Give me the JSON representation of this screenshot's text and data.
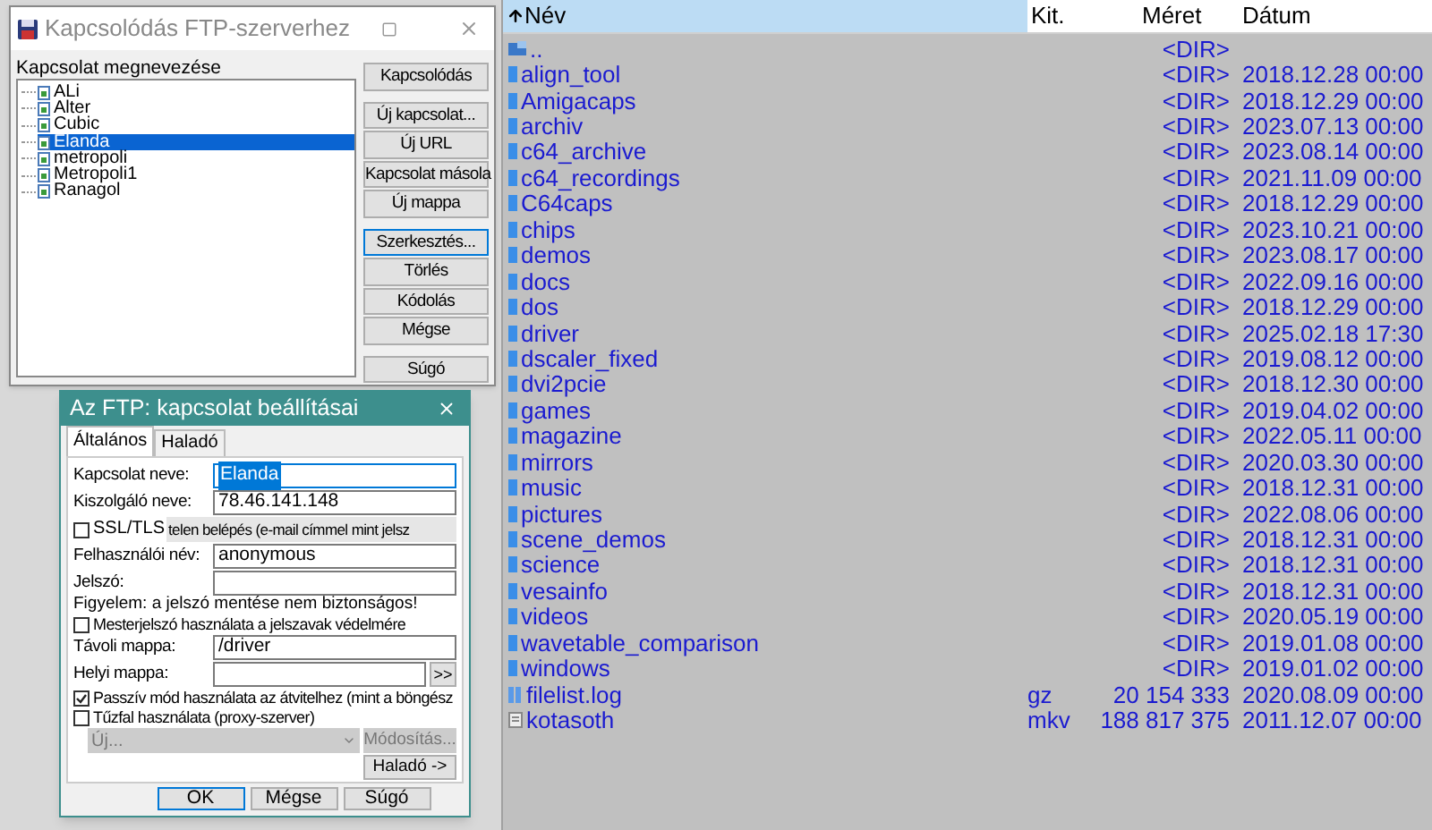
{
  "connect_dialog": {
    "title": "Kapcsolódás FTP-szerverhez",
    "list_label": "Kapcsolat megnevezése",
    "connections": [
      {
        "name": "ALi",
        "selected": false
      },
      {
        "name": "Alter",
        "selected": false
      },
      {
        "name": "Cubic",
        "selected": false
      },
      {
        "name": "Elanda",
        "selected": true
      },
      {
        "name": "metropoli",
        "selected": false
      },
      {
        "name": "Metropoli1",
        "selected": false
      },
      {
        "name": "Ranagol",
        "selected": false
      }
    ],
    "button_groups": [
      [
        {
          "label": "Kapcsolódás",
          "default": false
        }
      ],
      [
        {
          "label": "Új kapcsolat...",
          "default": false
        },
        {
          "label": "Új URL",
          "default": false
        },
        {
          "label": "Kapcsolat másola",
          "default": false
        },
        {
          "label": "Új mappa",
          "default": false
        }
      ],
      [
        {
          "label": "Szerkesztés...",
          "default": true
        },
        {
          "label": "Törlés",
          "default": false
        },
        {
          "label": "Kódolás",
          "default": false
        },
        {
          "label": "Mégse",
          "default": false
        }
      ],
      [
        {
          "label": "Súgó",
          "default": false
        }
      ]
    ]
  },
  "settings_dialog": {
    "title": "Az FTP: kapcsolat beállításai",
    "tabs": [
      {
        "label": "Általános",
        "selected": true
      },
      {
        "label": "Haladó",
        "selected": false
      }
    ],
    "rows": [
      {
        "kind": "field",
        "label": "Kapcsolat neve:",
        "value": "Elanda",
        "highlighted": true
      },
      {
        "kind": "field",
        "label": "Kiszolgáló neve:",
        "value": "78.46.141.148",
        "highlighted": false
      },
      {
        "kind": "check_overlap",
        "label": "SSL/TLS",
        "checked": false,
        "text": "telen belépés (e-mail címmel mint jelsz"
      },
      {
        "kind": "field",
        "label": "Felhasználói név:",
        "value": "anonymous",
        "highlighted": false
      },
      {
        "kind": "field",
        "label": "Jelszó:",
        "highlighted": false
      },
      {
        "kind": "note",
        "text": "Figyelem: a jelszó mentése nem biztonságos!"
      },
      {
        "kind": "checkbox",
        "label": "Mesterjelszó használata a jelszavak védelmére",
        "checked": false
      },
      {
        "kind": "field",
        "label": "Távoli mappa:",
        "value": "/driver",
        "highlighted": false
      },
      {
        "kind": "browse_field",
        "label": "Helyi mappa:",
        "button": ">>"
      },
      {
        "kind": "checkbox",
        "label": "Passzív mód használata az átvitelhez (mint a böngész",
        "checked": true
      },
      {
        "kind": "checkbox",
        "label": "Tűzfal használata (proxy-szerver)",
        "checked": false
      },
      {
        "kind": "proxy",
        "select": "Új...",
        "button": "Módosítás...",
        "disabled": true
      },
      {
        "kind": "button",
        "label": "Haladó ->"
      }
    ],
    "buttons": [
      {
        "label": "OK",
        "default": true
      },
      {
        "label": "Mégse",
        "default": false
      },
      {
        "label": "Súgó",
        "default": false
      }
    ]
  },
  "file_panel": {
    "columns": [
      {
        "label": "Név",
        "sorted": true
      },
      {
        "label": "Kit.",
        "sorted": false
      },
      {
        "label": "Méret",
        "sorted": false
      },
      {
        "label": "Dátum",
        "sorted": false
      }
    ],
    "rows": [
      {
        "kind": "up",
        "name": "..",
        "size": "<DIR>"
      },
      {
        "kind": "dir",
        "name": "align_tool",
        "size": "<DIR>",
        "date": "2018.12.28 00:00"
      },
      {
        "kind": "dir",
        "name": "Amigacaps",
        "size": "<DIR>",
        "date": "2018.12.29 00:00"
      },
      {
        "kind": "dir",
        "name": "archiv",
        "size": "<DIR>",
        "date": "2023.07.13 00:00"
      },
      {
        "kind": "dir",
        "name": "c64_archive",
        "size": "<DIR>",
        "date": "2023.08.14 00:00"
      },
      {
        "kind": "dir",
        "name": "c64_recordings",
        "size": "<DIR>",
        "date": "2021.11.09 00:00"
      },
      {
        "kind": "dir",
        "name": "C64caps",
        "size": "<DIR>",
        "date": "2018.12.29 00:00"
      },
      {
        "kind": "dir",
        "name": "chips",
        "size": "<DIR>",
        "date": "2023.10.21 00:00"
      },
      {
        "kind": "dir",
        "name": "demos",
        "size": "<DIR>",
        "date": "2023.08.17 00:00"
      },
      {
        "kind": "dir",
        "name": "docs",
        "size": "<DIR>",
        "date": "2022.09.16 00:00"
      },
      {
        "kind": "dir",
        "name": "dos",
        "size": "<DIR>",
        "date": "2018.12.29 00:00"
      },
      {
        "kind": "dir",
        "name": "driver",
        "size": "<DIR>",
        "date": "2025.02.18 17:30"
      },
      {
        "kind": "dir",
        "name": "dscaler_fixed",
        "size": "<DIR>",
        "date": "2019.08.12 00:00"
      },
      {
        "kind": "dir",
        "name": "dvi2pcie",
        "size": "<DIR>",
        "date": "2018.12.30 00:00"
      },
      {
        "kind": "dir",
        "name": "games",
        "size": "<DIR>",
        "date": "2019.04.02 00:00"
      },
      {
        "kind": "dir",
        "name": "magazine",
        "size": "<DIR>",
        "date": "2022.05.11 00:00"
      },
      {
        "kind": "dir",
        "name": "mirrors",
        "size": "<DIR>",
        "date": "2020.03.30 00:00"
      },
      {
        "kind": "dir",
        "name": "music",
        "size": "<DIR>",
        "date": "2018.12.31 00:00"
      },
      {
        "kind": "dir",
        "name": "pictures",
        "size": "<DIR>",
        "date": "2022.08.06 00:00"
      },
      {
        "kind": "dir",
        "name": "scene_demos",
        "size": "<DIR>",
        "date": "2018.12.31 00:00"
      },
      {
        "kind": "dir",
        "name": "science",
        "size": "<DIR>",
        "date": "2018.12.31 00:00"
      },
      {
        "kind": "dir",
        "name": "vesainfo",
        "size": "<DIR>",
        "date": "2018.12.31 00:00"
      },
      {
        "kind": "dir",
        "name": "videos",
        "size": "<DIR>",
        "date": "2020.05.19 00:00"
      },
      {
        "kind": "dir",
        "name": "wavetable_comparison",
        "size": "<DIR>",
        "date": "2019.01.08 00:00"
      },
      {
        "kind": "dir",
        "name": "windows",
        "size": "<DIR>",
        "date": "2019.01.02 00:00"
      },
      {
        "kind": "archive",
        "name": "filelist.log",
        "ext": "gz",
        "size": "20 154 333",
        "date": "2020.08.09 00:00"
      },
      {
        "kind": "file",
        "name": "kotasoth",
        "ext": "mkv",
        "size": "188 817 375",
        "date": "2011.12.07 00:00"
      }
    ]
  }
}
